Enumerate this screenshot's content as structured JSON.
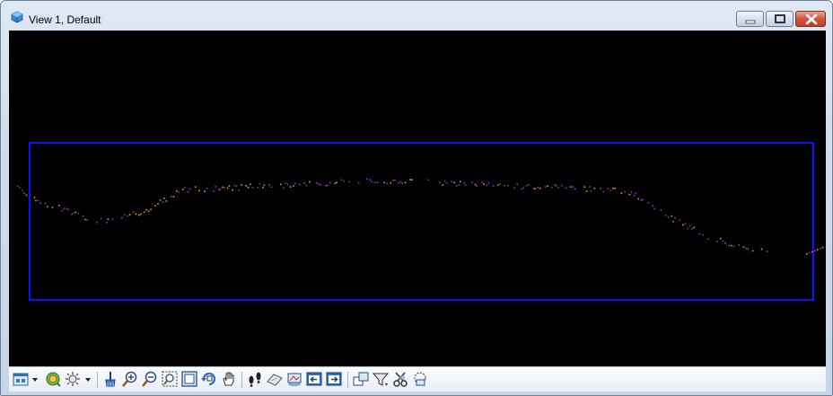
{
  "window": {
    "title": "View 1, Default",
    "controls": [
      "minimize",
      "maximize",
      "close"
    ]
  },
  "view": {
    "background_color": "#000000",
    "fence_color": "#0000ff",
    "point_colors": [
      "#a020f0",
      "#d6a21e",
      "#6b4a8a"
    ]
  },
  "toolbar": {
    "items": [
      "view-attributes-icon",
      "view-display-mode-icon",
      "view-lighting-icon",
      "update-view-icon",
      "zoom-in-icon",
      "zoom-out-icon",
      "window-area-icon",
      "fit-view-icon",
      "rotate-view-icon",
      "pan-view-icon",
      "walk-icon",
      "look-icon",
      "view-camera-icon",
      "view-previous-icon",
      "view-next-icon",
      "copy-view-icon",
      "clip-volume-icon",
      "clip-mask-icon",
      "clip-outline-icon"
    ]
  }
}
